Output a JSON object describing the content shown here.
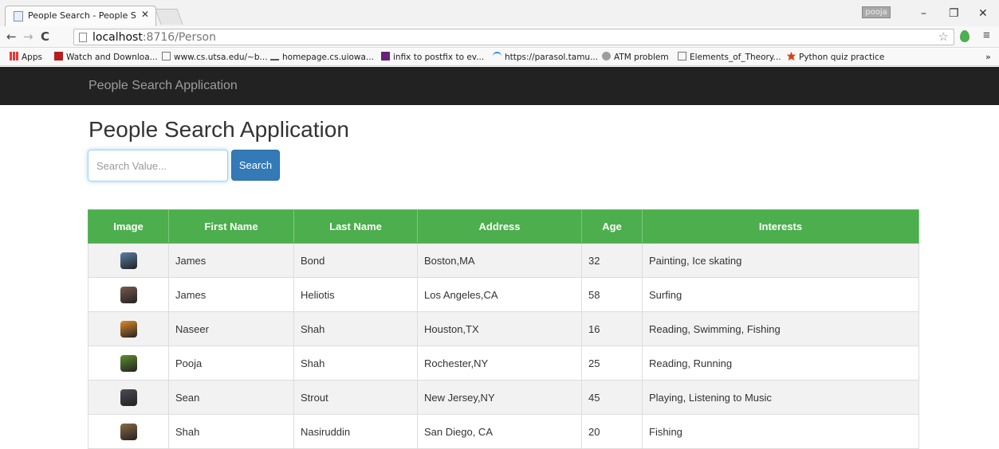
{
  "browser": {
    "tab_title": "People Search - People Se",
    "tab_close": "✕",
    "profile_name": "pooja",
    "url_host": "localhost",
    "url_rest": ":8716/Person",
    "bookmarks": [
      {
        "label": "Apps",
        "icon": "apps-grid-icon",
        "color": "#e53935"
      },
      {
        "label": "Watch and Downloa...",
        "icon": "movie-icon",
        "color": "#b71c1c"
      },
      {
        "label": "www.cs.utsa.edu/~b...",
        "icon": "page-icon",
        "color": "#ffffff"
      },
      {
        "label": "homepage.cs.uiowa...",
        "icon": "uiowa-icon",
        "color": "#555555"
      },
      {
        "label": "infix to postfix to ev...",
        "icon": "vs-icon",
        "color": "#68217a"
      },
      {
        "label": "https://parasol.tamu...",
        "icon": "arc-icon",
        "color": "#2196f3"
      },
      {
        "label": "ATM problem",
        "icon": "globe-icon",
        "color": "#9e9e9e"
      },
      {
        "label": "Elements_of_Theory...",
        "icon": "page-icon",
        "color": "#ffffff"
      },
      {
        "label": "Python quiz practice",
        "icon": "maple-leaf-icon",
        "color": "#d84315"
      }
    ],
    "more": "»"
  },
  "navbar": {
    "brand": "People Search Application"
  },
  "main": {
    "title": "People Search Application",
    "search_placeholder": "Search Value...",
    "search_label": "Search"
  },
  "table": {
    "headers": [
      "Image",
      "First Name",
      "Last Name",
      "Address",
      "Age",
      "Interests"
    ],
    "rows": [
      {
        "image": "landscape-thumb",
        "color": "#5b7fa8",
        "first": "James",
        "last": "Bond",
        "address": "Boston,MA",
        "age": "32",
        "interests": "Painting, Ice skating"
      },
      {
        "image": "abstract-thumb",
        "color": "#7a5a4f",
        "first": "James",
        "last": "Heliotis",
        "address": "Los Angeles,CA",
        "age": "58",
        "interests": "Surfing"
      },
      {
        "image": "sunset-thumb",
        "color": "#e08a2b",
        "first": "Naseer",
        "last": "Shah",
        "address": "Houston,TX",
        "age": "16",
        "interests": "Reading, Swimming, Fishing"
      },
      {
        "image": "vegetables-thumb",
        "color": "#5e8f2e",
        "first": "Pooja",
        "last": "Shah",
        "address": "Rochester,NY",
        "age": "25",
        "interests": "Reading, Running"
      },
      {
        "image": "jellyfish-thumb",
        "color": "#4e4a55",
        "first": "Sean",
        "last": "Strout",
        "address": "New Jersey,NY",
        "age": "45",
        "interests": "Playing, Listening to Music"
      },
      {
        "image": "lion-thumb",
        "color": "#8a6a45",
        "first": "Shah",
        "last": "Nasiruddin",
        "address": "San Diego, CA",
        "age": "20",
        "interests": "Fishing"
      }
    ]
  }
}
